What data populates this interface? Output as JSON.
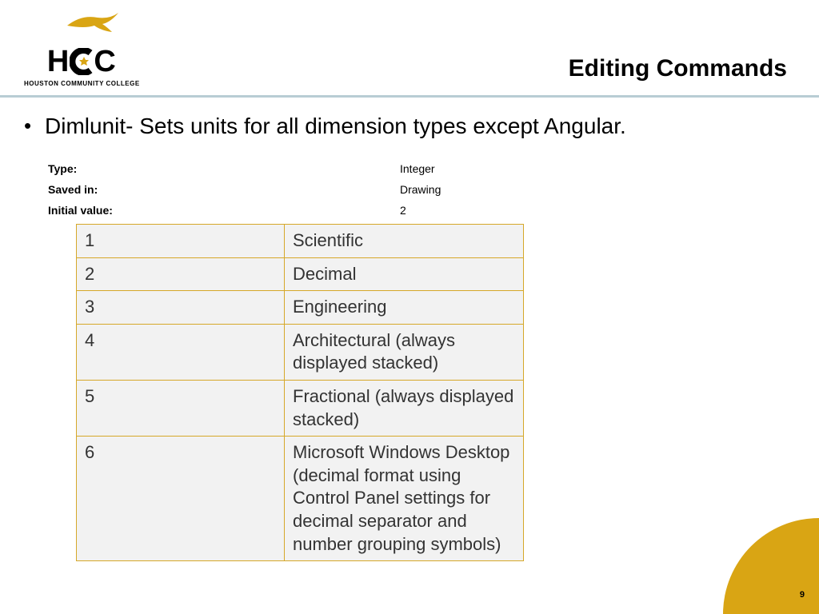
{
  "logo": {
    "main": "HCC",
    "sub": "HOUSTON COMMUNITY COLLEGE"
  },
  "title": "Editing Commands",
  "bullet": "Dimlunit- Sets units for all dimension types except Angular.",
  "meta": {
    "type_label": "Type:",
    "type_value": "Integer",
    "saved_label": "Saved in:",
    "saved_value": "Drawing",
    "initial_label": "Initial value:",
    "initial_value": "2"
  },
  "rows": [
    {
      "n": "1",
      "d": "Scientific"
    },
    {
      "n": "2",
      "d": "Decimal"
    },
    {
      "n": "3",
      "d": "Engineering"
    },
    {
      "n": "4",
      "d": "Architectural (always displayed stacked)"
    },
    {
      "n": "5",
      "d": "Fractional (always displayed stacked)"
    },
    {
      "n": "6",
      "d": "Microsoft Windows Desktop (decimal format using Control Panel settings for decimal separator and number grouping symbols)"
    }
  ],
  "page_number": "9"
}
